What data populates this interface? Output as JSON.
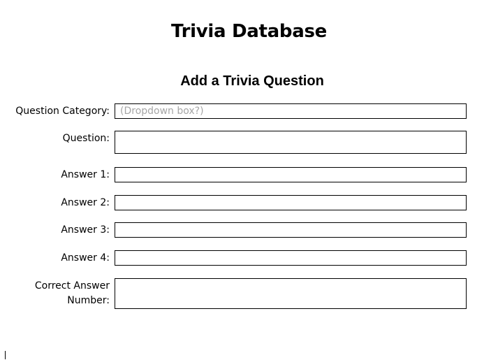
{
  "document": {
    "title": "Trivia Database",
    "section_title": "Add a Trivia Question"
  },
  "form": {
    "category": {
      "label": "Question Category:",
      "placeholder": "(Dropdown box?)"
    },
    "question": {
      "label": "Question:"
    },
    "answer1": {
      "label": "Answer 1:"
    },
    "answer2": {
      "label": "Answer 2:"
    },
    "answer3": {
      "label": "Answer 3:"
    },
    "answer4": {
      "label": "Answer 4:"
    },
    "correct_answer": {
      "label_line1": "Correct Answer",
      "label_line2": "Number:"
    }
  }
}
